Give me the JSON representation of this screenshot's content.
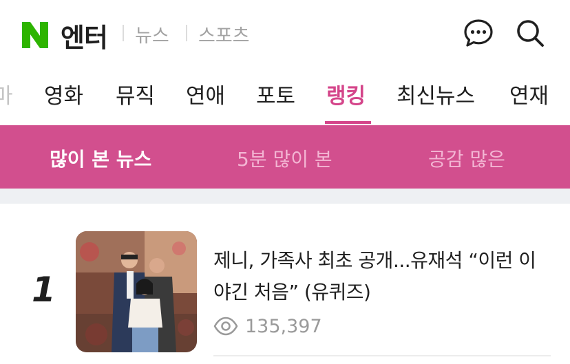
{
  "header": {
    "logo_letter": "N",
    "title": "엔터",
    "links": [
      "뉴스",
      "스포츠"
    ],
    "icons": [
      "chat-bubble-icon",
      "search-icon"
    ],
    "brand_color": "#2DB400"
  },
  "category_nav": {
    "items": [
      "마",
      "영화",
      "뮤직",
      "연애",
      "포토",
      "랭킹",
      "최신뉴스",
      "연재"
    ],
    "active": "랭킹",
    "accent_color": "#D4458A"
  },
  "ranking_tabs": {
    "items": [
      "많이 본 뉴스",
      "5분 많이 본",
      "공감 많은"
    ],
    "active": "많이 본 뉴스",
    "bar_color": "#D24F8E"
  },
  "articles": [
    {
      "rank": "1",
      "title": "제니, 가족사 최초 공개...유재석 “이런 이야긴 처음” (유퀴즈)",
      "views": "135,397"
    }
  ]
}
